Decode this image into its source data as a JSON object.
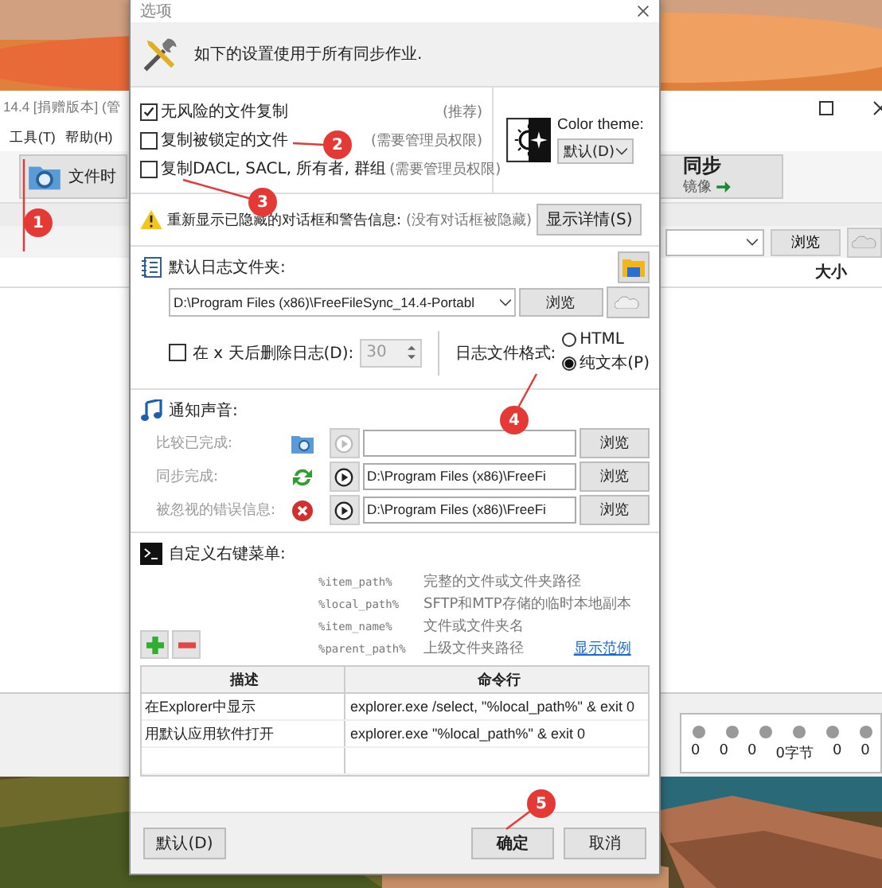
{
  "main_window": {
    "title": "14.4 [捐赠版本] (管",
    "menu": [
      {
        "label": "工具(T)"
      },
      {
        "label": "帮助(H)"
      }
    ],
    "left_tool": {
      "label": "文件时"
    },
    "right_tool": {
      "label": "同步",
      "sublabel": "镜像"
    },
    "browse_button": "浏览",
    "column_header": "大小",
    "stats": [
      "0",
      "0",
      "0",
      "0字节",
      "0",
      "0"
    ]
  },
  "dialog": {
    "title": "选项",
    "header": "如下的设置使用于所有同步作业.",
    "options": [
      {
        "label": "无风险的文件复制",
        "note": "(推荐)",
        "checked": true
      },
      {
        "label": "复制被锁定的文件",
        "note": "(需要管理员权限)",
        "checked": false
      },
      {
        "label": "复制DACL, SACL, 所有者, 群组",
        "note": "(需要管理员权限)",
        "checked": false
      }
    ],
    "color_theme": {
      "label": "Color theme:",
      "value": "默认(D)"
    },
    "hidden_dialogs": {
      "label": "重新显示已隐藏的对话框和警告信息:",
      "note": "(没有对话框被隐藏)",
      "button": "显示详情(S)"
    },
    "log": {
      "label": "默认日志文件夹:",
      "path": "D:\\Program Files (x86)\\FreeFileSync_14.4-Portabl",
      "browse": "浏览",
      "delete_after": {
        "label": "在 x 天后删除日志(D):",
        "checked": false,
        "value": "30"
      },
      "format_label": "日志文件格式:",
      "formats": [
        {
          "label": "HTML",
          "selected": false
        },
        {
          "label": "纯文本(P)",
          "selected": true
        }
      ]
    },
    "sounds": {
      "label": "通知声音:",
      "items": [
        {
          "label": "比较已完成:",
          "kind": "compare",
          "enabled": false,
          "browse": "浏览"
        },
        {
          "label": "同步完成:",
          "kind": "sync",
          "enabled": true,
          "path": "D:\\Program Files (x86)\\FreeFi",
          "browse": "浏览"
        },
        {
          "label": "被忽视的错误信息:",
          "kind": "error",
          "enabled": true,
          "path": "D:\\Program Files (x86)\\FreeFi",
          "browse": "浏览"
        }
      ]
    },
    "context_menu": {
      "label": "自定义右键菜单:",
      "macros": [
        {
          "name": "%item_path%",
          "description": "完整的文件或文件夹路径"
        },
        {
          "name": "%local_path%",
          "description": "SFTP和MTP存储的临时本地副本"
        },
        {
          "name": "%item_name%",
          "description": "文件或文件夹名"
        },
        {
          "name": "%parent_path%",
          "description": "上级文件夹路径"
        }
      ],
      "show_examples": "显示范例",
      "columns": [
        "描述",
        "命令行"
      ],
      "rows": [
        {
          "description": "在Explorer中显示",
          "command": "explorer.exe /select, \"%local_path%\" & exit 0"
        },
        {
          "description": "用默认应用软件打开",
          "command": "explorer.exe \"%local_path%\" & exit 0"
        }
      ]
    },
    "buttons": {
      "default": "默认(D)",
      "ok": "确定",
      "cancel": "取消"
    }
  },
  "annotations": [
    {
      "number": "1"
    },
    {
      "number": "2"
    },
    {
      "number": "3"
    },
    {
      "number": "4"
    },
    {
      "number": "5"
    }
  ]
}
